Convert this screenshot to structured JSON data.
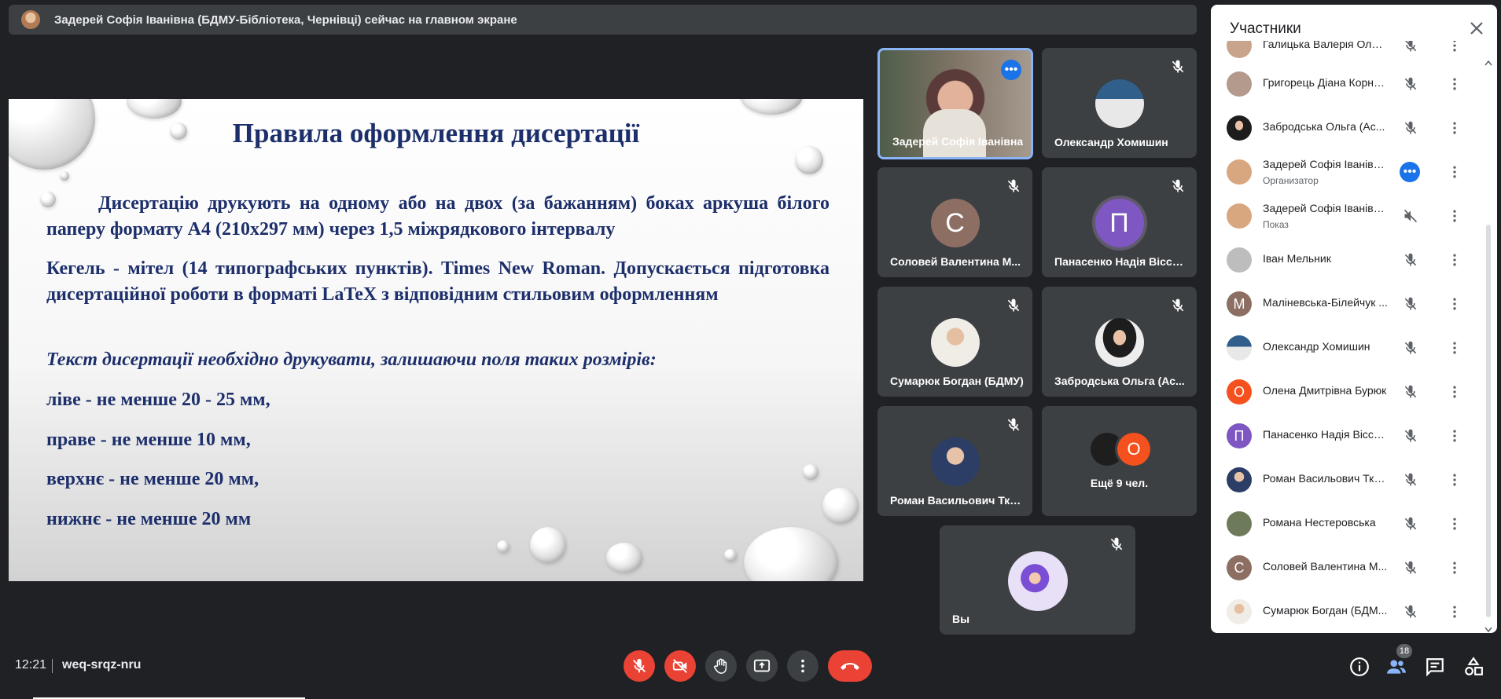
{
  "banner": {
    "text": "Задерей Софія Іванівна (БДМУ-Бібліотека, Чернівці) сейчас на главном экране"
  },
  "slide": {
    "title": "Правила  оформлення дисертації",
    "p1": "Дисертацію друкують на одному або на двох (за бажанням) боках аркуша білого паперу формату А4 (210x297 мм) через 1,5 міжрядкового інтервалу",
    "p2": "Кегель - мітел (14 типографських пунктів). Times New Roman. Допускається підготовка дисертаційної роботи в форматі LaTeX з відповідним стильовим оформленням",
    "p3": "Текст дисертації необхідно друкувати, залишаючи поля таких розмірів:",
    "lines": [
      "ліве - не менше 20 - 25 мм,",
      "праве - не менше 10 мм,",
      "верхнє - не менше 20 мм,",
      "нижнє - не менше 20 мм"
    ]
  },
  "tiles": [
    {
      "name": "Задерей Софія Іванівна"
    },
    {
      "name": "Олександр Хомишин"
    },
    {
      "name": "Соловей Валентина М...",
      "letter": "С",
      "color": "#8d6e63"
    },
    {
      "name": "Панасенко Надія Віссаріонівна",
      "letter": "П",
      "color": "#7e57c2"
    },
    {
      "name": "Сумарюк Богдан (БДМУ)"
    },
    {
      "name": "Забродська Ольга (Ас..."
    },
    {
      "name": "Роман Васильович Ткач..."
    },
    {
      "name": "Ещё 9 чел.",
      "letter": "О",
      "color": "#f4511e"
    },
    {
      "name": "Вы"
    }
  ],
  "panel": {
    "title": "Участники",
    "participants": [
      {
        "name": "Галицька Валерія Олек..."
      },
      {
        "name": "Григорець Діана Корне..."
      },
      {
        "name": "Забродська Ольга (Ас..."
      },
      {
        "name": "Задерей Софія Іванівн...",
        "sub": "Организатор"
      },
      {
        "name": "Задерей Софія Іванівн...",
        "sub": "Показ"
      },
      {
        "name": "Іван Мельник"
      },
      {
        "name": "Маліневська-Білейчук ...",
        "letter": "М",
        "color": "#8d6e63"
      },
      {
        "name": "Олександр Хомишин"
      },
      {
        "name": "Олена Дмитрівна Бурюк",
        "letter": "О",
        "color": "#f4511e"
      },
      {
        "name": "Панасенко Надія Віссa...",
        "letter": "П",
        "color": "#7e57c2"
      },
      {
        "name": "Роман Васильович Ткач..."
      },
      {
        "name": "Романа Нестеровська"
      },
      {
        "name": "Соловей Валентина М...",
        "letter": "С",
        "color": "#8d6e63"
      },
      {
        "name": "Сумарюк Богдан (БДМ..."
      }
    ]
  },
  "bottom": {
    "time": "12:21",
    "code": "weq-srqz-nru",
    "people_count": "18"
  },
  "colors": {
    "accent": "#8ab4f8",
    "red": "#ea4335",
    "blue": "#1a73e8"
  }
}
